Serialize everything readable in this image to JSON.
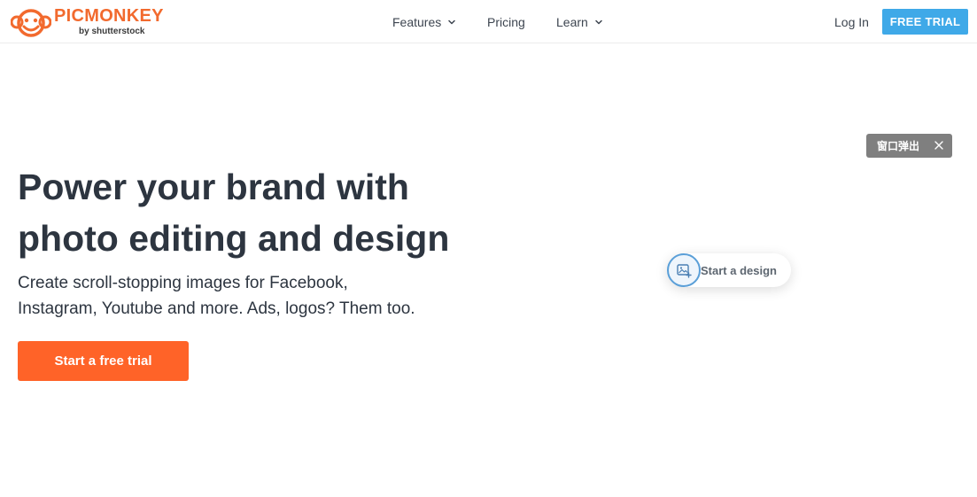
{
  "header": {
    "logo_name": "PICMONKEY",
    "logo_by": "by shutterstock",
    "nav": {
      "features": "Features",
      "pricing": "Pricing",
      "learn": "Learn"
    },
    "login": "Log In",
    "free_trial": "FREE TRIAL"
  },
  "hero": {
    "title_line1": "Power your brand with",
    "title_line2": "photo editing and design",
    "subtitle_line1": "Create scroll-stopping images for Facebook,",
    "subtitle_line2": "Instagram, Youtube and more. Ads, logos? Them too.",
    "cta": "Start a free trial"
  },
  "popup_chip": {
    "label": "窗口弹出"
  },
  "design_widget": {
    "label": "Start a design",
    "icon": "image-plus-icon"
  },
  "colors": {
    "brand_orange": "#f26a2e",
    "cta_orange": "#ff6328",
    "trial_blue": "#3fa9e8",
    "text_dark": "#2d3540"
  }
}
